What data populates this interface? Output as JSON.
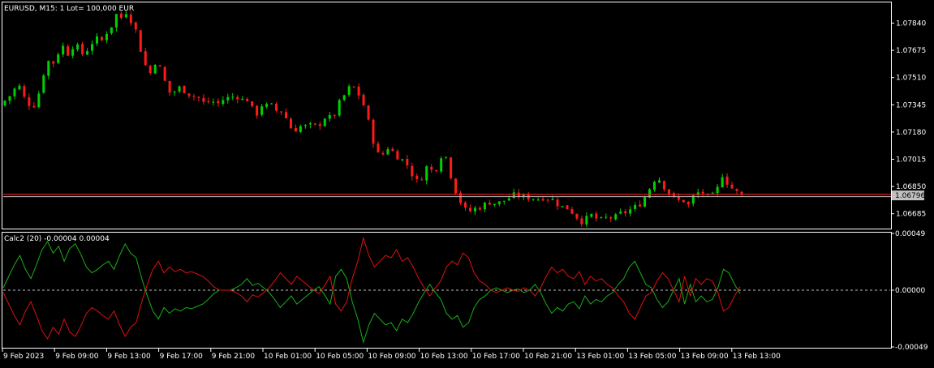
{
  "window": {
    "header_label": "EURUSD, M15:  1 Lot= 100,000 EUR"
  },
  "colors": {
    "background": "#000000",
    "frame": "#ffffff",
    "bull": "#00d000",
    "bear": "#ff1a1a",
    "price_line": "#ff2020",
    "ask_line": "#c0c0c0",
    "indicator_green": "#18b018",
    "indicator_red": "#e01010",
    "zero_line": "#c0c0c0"
  },
  "chart_data": [
    {
      "type": "candlestick",
      "symbol": "EURUSD",
      "timeframe": "M15",
      "ylim": [
        1.066,
        1.0796
      ],
      "y_ticks": [
        "1.07840",
        "1.07675",
        "1.07510",
        "1.07345",
        "1.07180",
        "1.07015",
        "1.06850",
        "1.06685"
      ],
      "y_tick_values": [
        1.0784,
        1.07675,
        1.0751,
        1.07345,
        1.0718,
        1.07015,
        1.0685,
        1.06685
      ],
      "current_price": 1.06796,
      "current_price_label": "1.06796",
      "close_path": [
        [
          0,
          1.0734
        ],
        [
          8,
          1.0738
        ],
        [
          16,
          1.0742
        ],
        [
          22,
          1.0748
        ],
        [
          28,
          1.074
        ],
        [
          34,
          1.0736
        ],
        [
          40,
          1.0733
        ],
        [
          46,
          1.0738
        ],
        [
          52,
          1.075
        ],
        [
          58,
          1.0762
        ],
        [
          64,
          1.0758
        ],
        [
          70,
          1.0765
        ],
        [
          78,
          1.077
        ],
        [
          86,
          1.0764
        ],
        [
          92,
          1.0774
        ],
        [
          98,
          1.0766
        ],
        [
          104,
          1.0765
        ],
        [
          110,
          1.077
        ],
        [
          118,
          1.0775
        ],
        [
          124,
          1.0772
        ],
        [
          130,
          1.0778
        ],
        [
          136,
          1.078
        ],
        [
          142,
          1.079
        ],
        [
          148,
          1.0786
        ],
        [
          154,
          1.0792
        ],
        [
          160,
          1.0787
        ],
        [
          166,
          1.0782
        ],
        [
          172,
          1.077
        ],
        [
          178,
          1.076
        ],
        [
          184,
          1.0752
        ],
        [
          190,
          1.0761
        ],
        [
          196,
          1.0758
        ],
        [
          202,
          1.075
        ],
        [
          208,
          1.0742
        ],
        [
          214,
          1.0742
        ],
        [
          220,
          1.0745
        ],
        [
          228,
          1.0743
        ],
        [
          236,
          1.074
        ],
        [
          244,
          1.0739
        ],
        [
          252,
          1.0735
        ],
        [
          260,
          1.0737
        ],
        [
          268,
          1.0735
        ],
        [
          276,
          1.0738
        ],
        [
          284,
          1.0739
        ],
        [
          292,
          1.074
        ],
        [
          300,
          1.0737
        ],
        [
          306,
          1.0738
        ],
        [
          312,
          1.073
        ],
        [
          318,
          1.0729
        ],
        [
          324,
          1.0736
        ],
        [
          330,
          1.0733
        ],
        [
          336,
          1.0734
        ],
        [
          342,
          1.073
        ],
        [
          348,
          1.0731
        ],
        [
          354,
          1.0725
        ],
        [
          360,
          1.0719
        ],
        [
          366,
          1.072
        ],
        [
          372,
          1.0722
        ],
        [
          378,
          1.0721
        ],
        [
          384,
          1.0722
        ],
        [
          390,
          1.0721
        ],
        [
          396,
          1.0724
        ],
        [
          402,
          1.0728
        ],
        [
          408,
          1.0726
        ],
        [
          414,
          1.073
        ],
        [
          420,
          1.0738
        ],
        [
          426,
          1.0741
        ],
        [
          432,
          1.0746
        ],
        [
          438,
          1.0744
        ],
        [
          444,
          1.0739
        ],
        [
          450,
          1.0732
        ],
        [
          456,
          1.072
        ],
        [
          462,
          1.0709
        ],
        [
          468,
          1.0702
        ],
        [
          474,
          1.0706
        ],
        [
          480,
          1.071
        ],
        [
          486,
          1.0704
        ],
        [
          492,
          1.0703
        ],
        [
          498,
          1.07
        ],
        [
          504,
          1.0697
        ],
        [
          510,
          1.069
        ],
        [
          516,
          1.0687
        ],
        [
          522,
          1.0693
        ],
        [
          528,
          1.0699
        ],
        [
          534,
          1.0692
        ],
        [
          540,
          1.0699
        ],
        [
          546,
          1.0707
        ],
        [
          552,
          1.07
        ],
        [
          558,
          1.0686
        ],
        [
          564,
          1.068
        ],
        [
          570,
          1.0673
        ],
        [
          576,
          1.0669
        ],
        [
          582,
          1.0671
        ],
        [
          588,
          1.0672
        ],
        [
          594,
          1.0673
        ],
        [
          600,
          1.0675
        ],
        [
          606,
          1.0676
        ],
        [
          612,
          1.0674
        ],
        [
          618,
          1.0676
        ],
        [
          624,
          1.0677
        ],
        [
          630,
          1.0679
        ],
        [
          636,
          1.068
        ],
        [
          642,
          1.0679
        ],
        [
          648,
          1.0678
        ],
        [
          654,
          1.0679
        ],
        [
          660,
          1.0677
        ],
        [
          666,
          1.0678
        ],
        [
          672,
          1.0679
        ],
        [
          678,
          1.0677
        ],
        [
          684,
          1.0677
        ],
        [
          690,
          1.0672
        ],
        [
          696,
          1.0673
        ],
        [
          702,
          1.0671
        ],
        [
          708,
          1.0668
        ],
        [
          714,
          1.0665
        ],
        [
          720,
          1.0663
        ],
        [
          726,
          1.0668
        ],
        [
          732,
          1.0667
        ],
        [
          738,
          1.0664
        ],
        [
          744,
          1.0665
        ],
        [
          750,
          1.0667
        ],
        [
          756,
          1.0665
        ],
        [
          762,
          1.0668
        ],
        [
          768,
          1.0669
        ],
        [
          774,
          1.067
        ],
        [
          780,
          1.0672
        ],
        [
          786,
          1.0673
        ],
        [
          792,
          1.0677
        ],
        [
          798,
          1.0681
        ],
        [
          804,
          1.0688
        ],
        [
          810,
          1.0691
        ],
        [
          816,
          1.0687
        ],
        [
          822,
          1.0682
        ],
        [
          828,
          1.068
        ],
        [
          834,
          1.0674
        ],
        [
          840,
          1.068
        ],
        [
          846,
          1.0671
        ],
        [
          852,
          1.0678
        ],
        [
          858,
          1.068
        ],
        [
          864,
          1.0683
        ],
        [
          870,
          1.0678
        ],
        [
          876,
          1.068
        ],
        [
          882,
          1.0678
        ],
        [
          888,
          1.0694
        ],
        [
          894,
          1.0689
        ],
        [
          900,
          1.0685
        ],
        [
          906,
          1.0682
        ],
        [
          912,
          1.068
        ],
        [
          914,
          1.06796
        ]
      ],
      "visible_candles": 153
    },
    {
      "type": "line",
      "title": "Calc2 (20) -0.00004 0.00004",
      "ylim": [
        -0.00049,
        0.00049
      ],
      "y_ticks": [
        "0.00049",
        "0.00000",
        "-0.00049"
      ],
      "y_tick_values": [
        0.00049,
        0.0,
        -0.00049
      ],
      "zero_line": 0.0,
      "x_categories": [
        "9 Feb 2023",
        "9 Feb 09:00",
        "9 Feb 13:00",
        "9 Feb 17:00",
        "9 Feb 21:00",
        "10 Feb 01:00",
        "10 Feb 05:00",
        "10 Feb 09:00",
        "10 Feb 13:00",
        "10 Feb 17:00",
        "10 Feb 21:00",
        "13 Feb 01:00",
        "13 Feb 05:00",
        "13 Feb 09:00",
        "13 Feb 13:00"
      ],
      "series": [
        {
          "color": "#18b018",
          "values": [
            2e-05,
            0.00012,
            0.00022,
            0.0003,
            0.00018,
            0.0001,
            0.00022,
            0.00035,
            0.00042,
            0.00032,
            0.00038,
            0.00025,
            0.00036,
            0.0004,
            0.00031,
            0.0002,
            0.00015,
            0.00018,
            0.00022,
            0.00025,
            0.00018,
            0.0003,
            0.0004,
            0.00032,
            0.00028,
            0.0001,
            -5e-05,
            -0.00018,
            -0.00025,
            -0.00015,
            -0.0002,
            -0.00016,
            -0.00018,
            -0.00015,
            -0.00016,
            -0.00014,
            -0.00012,
            -8e-05,
            -3e-05,
            0.0,
            0.0,
            0.0,
            2e-05,
            5e-05,
            0.0001,
            4e-05,
            6e-05,
            2e-05,
            -2e-05,
            -8e-05,
            -0.00015,
            -0.0001,
            -5e-05,
            -0.00012,
            -8e-05,
            -4e-05,
            0.0,
            3e-05,
            -4e-05,
            -0.00012,
            0.00012,
            0.00018,
            0.0001,
            -0.0001,
            -0.00025,
            -0.00045,
            -0.0003,
            -0.0002,
            -0.00025,
            -0.0003,
            -0.00028,
            -0.00035,
            -0.00025,
            -0.00028,
            -0.0002,
            -0.0001,
            -2e-05,
            5e-05,
            -2e-05,
            -8e-05,
            -0.0002,
            -0.00025,
            -0.00022,
            -0.00032,
            -0.00028,
            -0.00015,
            -8e-05,
            -5e-05,
            0.0,
            2e-05,
            0.0,
            -2e-05,
            0.0,
            1e-05,
            -2e-05,
            0.0,
            5e-05,
            -2e-05,
            -0.00012,
            -0.0002,
            -0.00015,
            -0.00018,
            -0.00012,
            -0.0001,
            -0.00016,
            -5e-05,
            -0.00012,
            -8e-05,
            -0.0001,
            -5e-05,
            -2e-05,
            5e-05,
            0.0001,
            0.0002,
            0.00025,
            0.00015,
            5e-05,
            2e-05,
            -8e-05,
            -0.00015,
            -0.0001,
            0.0,
            0.0001,
            -0.00012,
            5e-05,
            -0.0001,
            -5e-05,
            -0.0001,
            -8e-05,
            2e-05,
            0.00018,
            0.00015,
            5e-05,
            -3e-05
          ]
        },
        {
          "color": "#e01010",
          "values": [
            -2e-05,
            -0.00012,
            -0.00022,
            -0.0003,
            -0.00018,
            -0.0001,
            -0.00022,
            -0.00035,
            -0.00042,
            -0.00032,
            -0.00038,
            -0.00025,
            -0.00036,
            -0.0004,
            -0.00031,
            -0.0002,
            -0.00015,
            -0.00018,
            -0.00022,
            -0.00025,
            -0.00018,
            -0.0003,
            -0.0004,
            -0.00032,
            -0.00028,
            -0.0001,
            5e-05,
            0.00018,
            0.00025,
            0.00015,
            0.0002,
            0.00016,
            0.00018,
            0.00015,
            0.00016,
            0.00014,
            0.00012,
            8e-05,
            3e-05,
            0.0,
            0.0,
            0.0,
            -2e-05,
            -5e-05,
            -0.0001,
            -4e-05,
            -6e-05,
            -2e-05,
            2e-05,
            8e-05,
            0.00015,
            0.0001,
            5e-05,
            0.00012,
            8e-05,
            4e-05,
            0.0,
            -3e-05,
            4e-05,
            0.00012,
            -0.00012,
            -0.00018,
            -0.0001,
            0.0001,
            0.00025,
            0.00045,
            0.0003,
            0.0002,
            0.00025,
            0.0003,
            0.00028,
            0.00035,
            0.00025,
            0.00028,
            0.0002,
            0.0001,
            2e-05,
            -5e-05,
            2e-05,
            8e-05,
            0.0002,
            0.00025,
            0.00022,
            0.00032,
            0.00028,
            0.00015,
            8e-05,
            5e-05,
            0.0,
            -2e-05,
            0.0,
            2e-05,
            0.0,
            -1e-05,
            2e-05,
            0.0,
            -5e-05,
            2e-05,
            0.00012,
            0.0002,
            0.00015,
            0.00018,
            0.00012,
            0.0001,
            0.00016,
            5e-05,
            0.00012,
            8e-05,
            0.0001,
            5e-05,
            2e-05,
            -5e-05,
            -0.0001,
            -0.0002,
            -0.00025,
            -0.00015,
            -5e-05,
            -2e-05,
            8e-05,
            0.00015,
            0.0001,
            0.0,
            -0.0001,
            0.00012,
            -5e-05,
            0.0001,
            5e-05,
            0.0001,
            8e-05,
            -2e-05,
            -0.00018,
            -0.00015,
            -5e-05,
            3e-05
          ]
        }
      ]
    }
  ]
}
